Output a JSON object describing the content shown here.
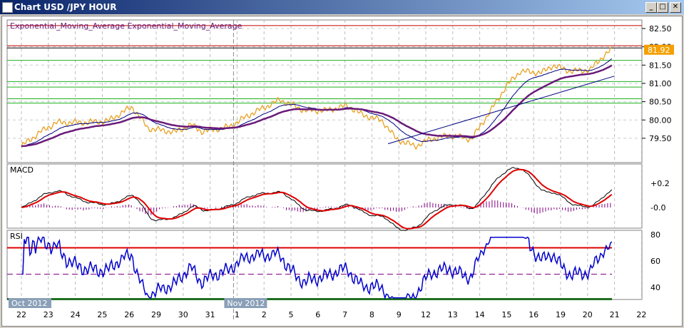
{
  "window": {
    "title": "Chart USD /JPY  HOUR",
    "minimize": "_",
    "maximize": "□",
    "close": "✕"
  },
  "indicator_label": "Exponential_Moving_Average Exponential_Moving_Average",
  "macd_label": "MACD",
  "rsi_label": "RSI",
  "current_price": "81.92",
  "colors": {
    "price": "#e8a020",
    "ema_fast": "#000080",
    "ema_slow": "#6a1a7a",
    "macd": "#000000",
    "signal": "#e00000",
    "rsi": "#0000cc",
    "rsi_overbought": "#e040e0",
    "current": "#f5a000"
  },
  "chart_data": {
    "type": "line",
    "title": "Chart USD /JPY HOUR",
    "price_ticks": [
      "82.50",
      "82.00",
      "81.50",
      "81.00",
      "80.50",
      "80.00",
      "79.50"
    ],
    "price_tick_values": [
      82.5,
      82.0,
      81.5,
      81.0,
      80.5,
      80.0,
      79.5
    ],
    "ylim": [
      79.2,
      82.6
    ],
    "macd_ticks": [
      "+0.2",
      "-0.0"
    ],
    "rsi_ticks": [
      "80",
      "60",
      "40"
    ],
    "rsi_levels": [
      70,
      50,
      30
    ],
    "horizontal_levels": {
      "red": [
        82.58,
        82.03
      ],
      "black": [
        81.97
      ],
      "green": [
        81.63,
        81.05,
        80.9,
        80.58,
        80.46
      ]
    },
    "trendline": {
      "from": [
        13.6,
        79.35
      ],
      "to": [
        22,
        81.2
      ]
    },
    "month_labels": [
      {
        "label": "Oct 2012",
        "day_index": 0
      },
      {
        "label": "Nov 2012",
        "day_index": 8
      }
    ],
    "x_ticks": [
      "22",
      "23",
      "24",
      "25",
      "26",
      "29",
      "30",
      "31",
      "1",
      "2",
      "5",
      "6",
      "7",
      "8",
      "9",
      "12",
      "13",
      "14",
      "15",
      "16",
      "19",
      "20",
      "21",
      "22"
    ],
    "price_series": [
      [
        0,
        79.28
      ],
      [
        0.7,
        79.67
      ],
      [
        1.3,
        79.93
      ],
      [
        2.3,
        79.93
      ],
      [
        3.2,
        79.97
      ],
      [
        4.1,
        80.36
      ],
      [
        4.7,
        79.77
      ],
      [
        5.7,
        79.67
      ],
      [
        6.3,
        79.87
      ],
      [
        6.7,
        79.68
      ],
      [
        7.7,
        79.81
      ],
      [
        8.5,
        80.16
      ],
      [
        9.6,
        80.55
      ],
      [
        10.5,
        80.26
      ],
      [
        11.3,
        80.26
      ],
      [
        12.1,
        80.39
      ],
      [
        12.6,
        80.16
      ],
      [
        13.4,
        79.97
      ],
      [
        13.9,
        79.48
      ],
      [
        14.6,
        79.28
      ],
      [
        15.2,
        79.48
      ],
      [
        15.9,
        79.58
      ],
      [
        16.7,
        79.48
      ],
      [
        17.5,
        80.36
      ],
      [
        18.0,
        80.94
      ],
      [
        18.5,
        81.33
      ],
      [
        19.3,
        81.29
      ],
      [
        19.7,
        81.49
      ],
      [
        20.4,
        81.33
      ],
      [
        21.1,
        81.37
      ],
      [
        21.6,
        81.76
      ],
      [
        21.9,
        81.92
      ]
    ]
  }
}
